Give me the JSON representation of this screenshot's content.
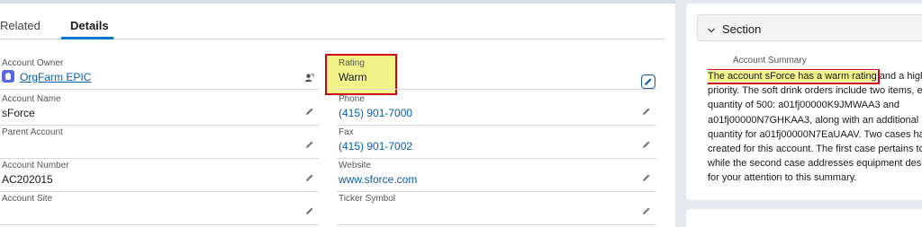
{
  "tabs": [
    {
      "label": "Related"
    },
    {
      "label": "Details"
    }
  ],
  "fields": {
    "account_owner": {
      "label": "Account Owner",
      "value": "OrgFarm EPIC"
    },
    "rating": {
      "label": "Rating",
      "value": "Warm"
    },
    "account_name": {
      "label": "Account Name",
      "value": "sForce"
    },
    "phone": {
      "label": "Phone",
      "value": "(415) 901-7000"
    },
    "parent_account": {
      "label": "Parent Account",
      "value": ""
    },
    "fax": {
      "label": "Fax",
      "value": "(415) 901-7002"
    },
    "account_number": {
      "label": "Account Number",
      "value": "AC202015"
    },
    "website": {
      "label": "Website",
      "value": "www.sforce.com"
    },
    "account_site": {
      "label": "Account Site",
      "value": ""
    },
    "ticker_symbol": {
      "label": "Ticker Symbol",
      "value": ""
    }
  },
  "section": {
    "title": "Section",
    "summary_label": "Account Summary",
    "summary_highlight": "The account sForce has a warm rating",
    "summary_lines": [
      " and a high c",
      "priority. The soft drink orders include two items, ea",
      "quantity of 500: a01fj00000K9JMWAA3 and",
      "a01fj00000N7GHKAA3, along with an additional u",
      "quantity for a01fj00000N7EaUAAV. Two cases have",
      "created for this account. The first case pertains to",
      "while the second case addresses equipment desig",
      "for your attention to this summary."
    ]
  },
  "colors": {
    "accent": "#0176d3",
    "link": "#0b5cab",
    "highlight": "#f2f48a",
    "highlight_border": "#d0021b"
  },
  "icons": [
    "owner-avatar-icon",
    "change-owner-icon",
    "pencil-icon",
    "edit-icon",
    "chevron-down-icon"
  ]
}
